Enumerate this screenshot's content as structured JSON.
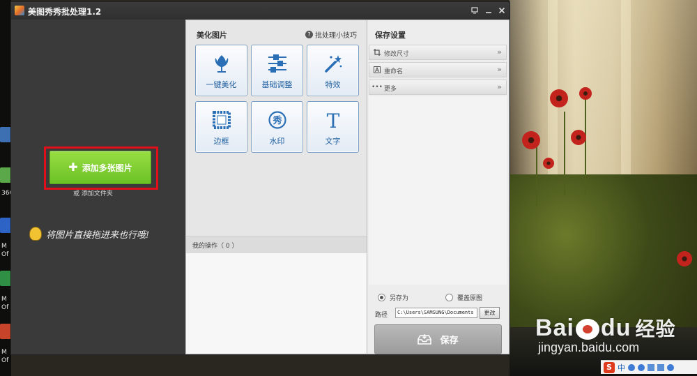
{
  "window": {
    "title": "美图秀秀批处理1.2",
    "buttons": {
      "menu_icon": "menu-icon",
      "minimize_icon": "minimize-icon",
      "close_icon": "close-icon"
    }
  },
  "left_panel": {
    "add_button_label": "添加多张图片",
    "add_folder_text": "或 添加文件夹",
    "drag_hint": "将图片直接拖进来也行哦!"
  },
  "beautify": {
    "title": "美化图片",
    "tips": "批处理小技巧",
    "tools": [
      {
        "label": "一键美化",
        "icon": "tulip-icon"
      },
      {
        "label": "基础调整",
        "icon": "sliders-icon"
      },
      {
        "label": "特效",
        "icon": "magic-wand-icon"
      },
      {
        "label": "边框",
        "icon": "frame-icon"
      },
      {
        "label": "水印",
        "icon": "watermark-icon",
        "glyph": "秀"
      },
      {
        "label": "文字",
        "icon": "text-icon",
        "glyph": "T"
      }
    ],
    "my_operations": "我的操作（ 0 ）"
  },
  "save_settings": {
    "title": "保存设置",
    "sections": [
      {
        "label": "修改尺寸",
        "icon": "crop-icon"
      },
      {
        "label": "重命名",
        "icon": "rename-icon"
      },
      {
        "label": "更多",
        "icon": "more-icon"
      }
    ],
    "save_as_label": "另存为",
    "overwrite_label": "覆盖原图",
    "selected_option": "另存为",
    "path_label": "路径",
    "path_value": "C:\\Users\\SAMSUNG\\Documents",
    "change_button": "更改",
    "save_button": "保存"
  },
  "desktop": {
    "icon_labels": [
      "360",
      "M",
      "Of",
      "M",
      "Of",
      "M",
      "Of"
    ],
    "watermark_logo": "Bai",
    "watermark_logo_tail": "du",
    "watermark_cn": "经验",
    "watermark_url": "jingyan.baidu.com",
    "ime_label": "中"
  },
  "colors": {
    "add_button": "#79c82c",
    "highlight_box": "#e0101a",
    "tool_label": "#1f5fa0",
    "tool_icon": "#2a6fb5"
  }
}
